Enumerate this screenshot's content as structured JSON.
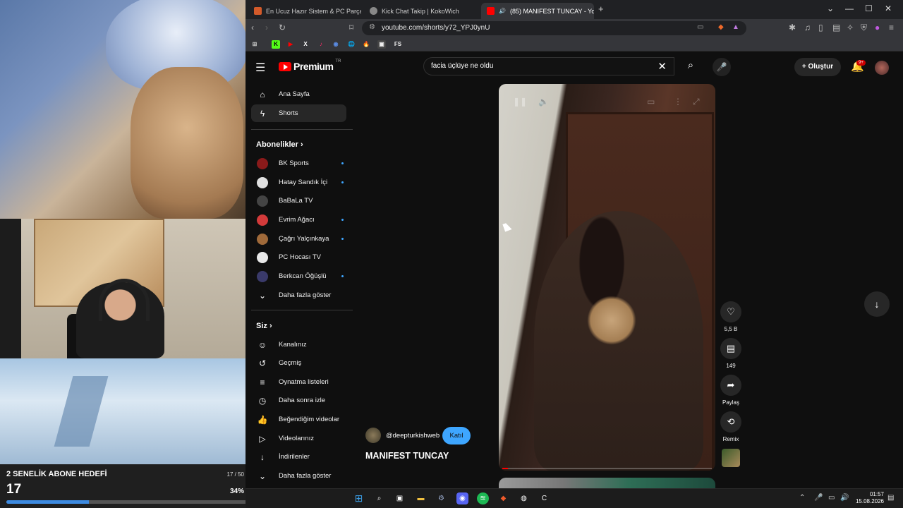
{
  "stream_overlay": {
    "goal_title": "2 SENELİK ABONE HEDEFİ",
    "goal_fraction": "17 / 50",
    "goal_count": "17",
    "goal_percent": "34%",
    "goal_progress": 0.34
  },
  "browser": {
    "tabs": [
      {
        "label": "En Ucuz Hazır Sistem & PC Parça Fiya",
        "active": false
      },
      {
        "label": "Kick Chat Takip | KokoWich",
        "active": false
      },
      {
        "label": "(85) MANIFEST TUNCAY - You",
        "active": true
      }
    ],
    "url": "youtube.com/shorts/y72_YPJ0ynU",
    "bookmarks": [
      "K",
      "▶",
      "X",
      "♪",
      "◉",
      "🌐",
      "🔥",
      "▣",
      "FS"
    ]
  },
  "youtube": {
    "logo_text": "Premium",
    "logo_country": "TR",
    "search_value": "facia üçlüye ne oldu",
    "create_label": "Oluştur",
    "notif_badge": "9+",
    "nav": [
      {
        "label": "Ana Sayfa",
        "icon": "home-icon",
        "active": false
      },
      {
        "label": "Shorts",
        "icon": "shorts-icon",
        "active": true
      }
    ],
    "subs_title": "Abonelikler",
    "subscriptions": [
      {
        "label": "BK Sports",
        "dot": true,
        "color": "#8a1a1a"
      },
      {
        "label": "Hatay Sandık İçi",
        "dot": true,
        "color": "#e0e0e0"
      },
      {
        "label": "BaBaLa TV",
        "dot": false,
        "color": "#444444"
      },
      {
        "label": "Evrim Ağacı",
        "dot": true,
        "color": "#d33a3a"
      },
      {
        "label": "Çağrı Yalçınkaya",
        "dot": true,
        "color": "#a06a3a"
      },
      {
        "label": "PC Hocası TV",
        "dot": false,
        "color": "#e8e8e8"
      },
      {
        "label": "Berkcan Öğüşlü",
        "dot": true,
        "color": "#3a3a6a"
      }
    ],
    "subs_more": "Daha fazla göster",
    "you_title": "Siz",
    "you_items": [
      {
        "label": "Kanalınız",
        "icon": "channel-icon"
      },
      {
        "label": "Geçmiş",
        "icon": "history-icon"
      },
      {
        "label": "Oynatma listeleri",
        "icon": "playlist-icon"
      },
      {
        "label": "Daha sonra izle",
        "icon": "watch-later-icon"
      },
      {
        "label": "Beğendiğim videolar",
        "icon": "liked-icon"
      },
      {
        "label": "Videolarınız",
        "icon": "your-videos-icon"
      },
      {
        "label": "İndirilenler",
        "icon": "download-icon"
      },
      {
        "label": "Daha fazla göster",
        "icon": "chevron-down-icon"
      }
    ],
    "short": {
      "channel_handle": "@deepturkishweb",
      "join_label": "Katıl",
      "title": "MANIFEST TUNCAY",
      "likes": "5,5 B",
      "comments": "149",
      "share_label": "Paylaş",
      "remix_label": "Remix"
    }
  },
  "taskbar": {
    "time": "01:57",
    "date": "15.08.2026"
  }
}
